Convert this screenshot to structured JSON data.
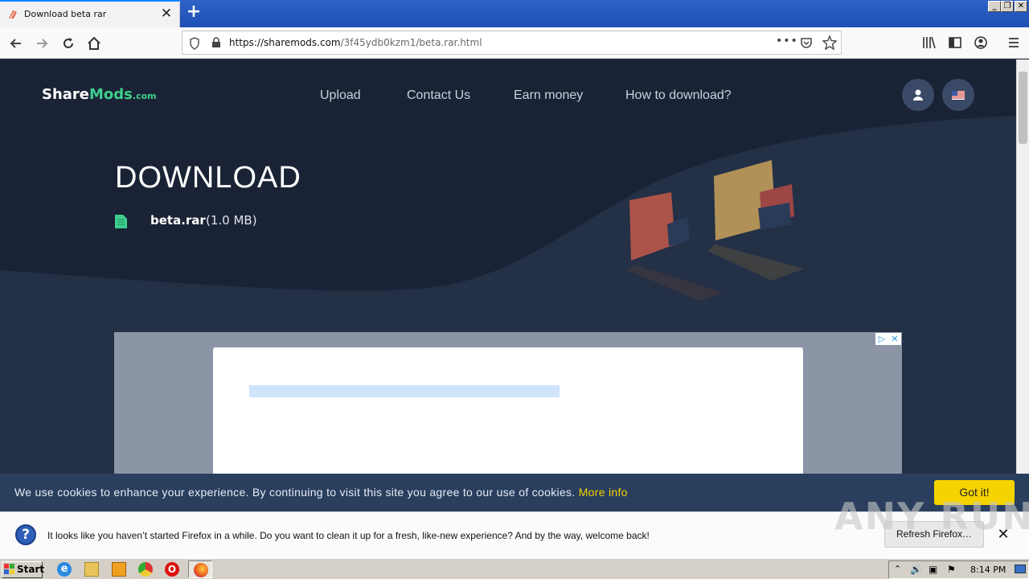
{
  "browser": {
    "tab_title": "Download beta rar",
    "url_host": "https://sharemods.com",
    "url_path": "/3f45ydb0kzm1/beta.rar.html",
    "window_controls": [
      "_",
      "❐",
      "✕"
    ]
  },
  "site": {
    "logo": {
      "part1": "Share",
      "part2": "Mods",
      "part3": ".com"
    },
    "menu": [
      "Upload",
      "Contact Us",
      "Earn money",
      "How to download?"
    ],
    "heading": "DOWNLOAD",
    "file_name": "beta.rar",
    "file_size": "(1.0 MB)"
  },
  "ad": {
    "choices_icon": "▷",
    "close_icon": "✕"
  },
  "cookie": {
    "text": "We use cookies to enhance your experience. By continuing to visit this site you agree to our use of cookies.",
    "more_info": "More info",
    "button": "Got it!"
  },
  "notification": {
    "text": "It looks like you haven’t started Firefox in a while. Do you want to clean it up for a fresh, like-new experience? And by the way, welcome back!",
    "button": "Refresh Firefox…",
    "close": "✕"
  },
  "watermark": "ANY RUN",
  "taskbar": {
    "start": "Start",
    "clock": "8:14 PM"
  },
  "colors": {
    "accent": "#3ecf8e",
    "page_bg": "#233046",
    "cookie_button": "#f5d300"
  }
}
